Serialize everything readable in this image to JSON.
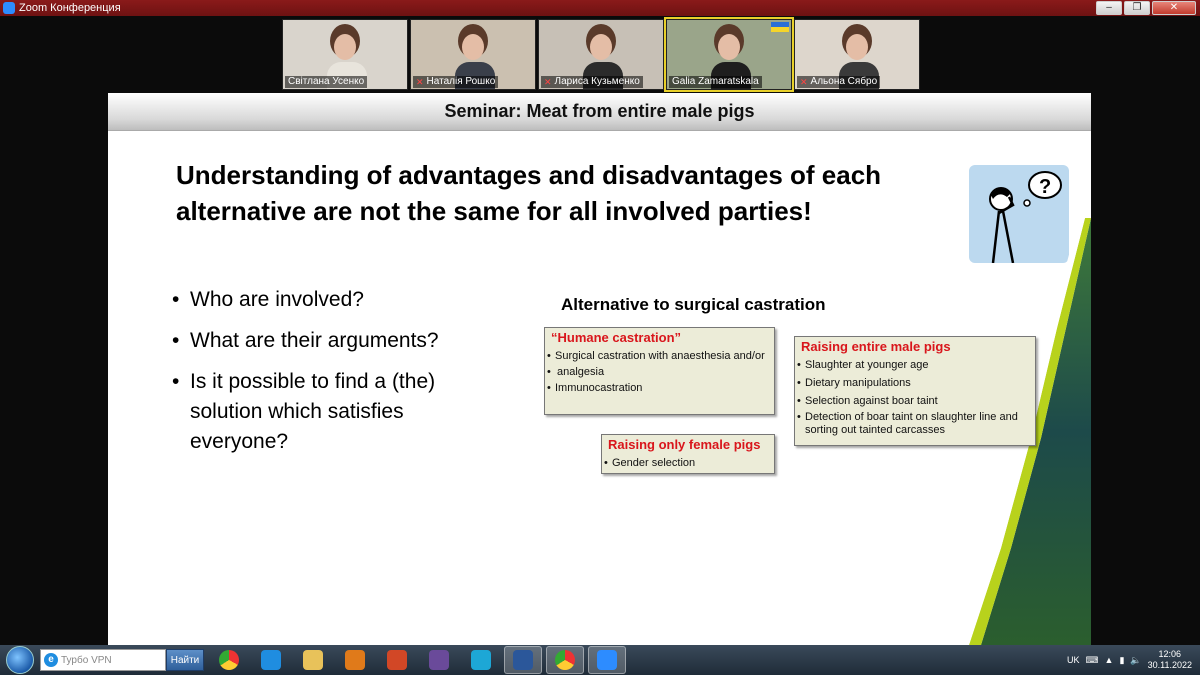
{
  "window": {
    "title": "Zoom Конференция",
    "controls": [
      "–",
      "❐",
      "✕"
    ]
  },
  "participants": [
    {
      "name": "Світлана Усенко",
      "muted": false,
      "bg": "#d9d4cc",
      "shirt": "#e8e4dc"
    },
    {
      "name": "Наталія Рошко",
      "muted": true,
      "bg": "#cbc0b0",
      "shirt": "#3a3f4a"
    },
    {
      "name": "Лариса Кузьменко",
      "muted": true,
      "bg": "#c7c0b6",
      "shirt": "#2b2b2b"
    },
    {
      "name": "Galia Zamaratskala",
      "muted": false,
      "bg": "#9aa58a",
      "shirt": "#1e1e1e",
      "speaking": true
    },
    {
      "name": "Альона Сябро",
      "muted": true,
      "bg": "#ddd6cc",
      "shirt": "#3a3a3a"
    }
  ],
  "slide": {
    "header": "Seminar: Meat from entire male pigs",
    "heading": "Understanding of advantages and disadvantages of each alternative are not the same for all involved parties!",
    "bullets": [
      "Who are involved?",
      "What are their arguments?",
      "Is it possible to find a (the) solution which satisfies everyone?"
    ],
    "alt_title": "Alternative to surgical castration",
    "boxes": {
      "humane": {
        "title": "“Humane castration”",
        "items": [
          "Surgical castration with anaesthesia and/or",
          "analgesia",
          "Immunocastration"
        ]
      },
      "female": {
        "title": "Raising only female pigs",
        "items": [
          "Gender selection"
        ]
      },
      "entire": {
        "title": "Raising entire male pigs",
        "items": [
          "Slaughter at younger age",
          "Dietary manipulations",
          "Selection against boar taint",
          "Detection of boar taint on slaughter line and sorting out tainted carcasses"
        ]
      }
    }
  },
  "taskbar": {
    "search_placeholder": "Турбо VPN",
    "search_button": "Найти",
    "apps": [
      "chrome-icon",
      "ie-icon",
      "folder-icon",
      "media-player-icon",
      "powerpoint-icon",
      "film-icon",
      "edge-icon",
      "word-icon",
      "chrome-icon",
      "zoom-icon"
    ],
    "language": "UK",
    "time": "12:06",
    "date": "30.11.2022"
  }
}
